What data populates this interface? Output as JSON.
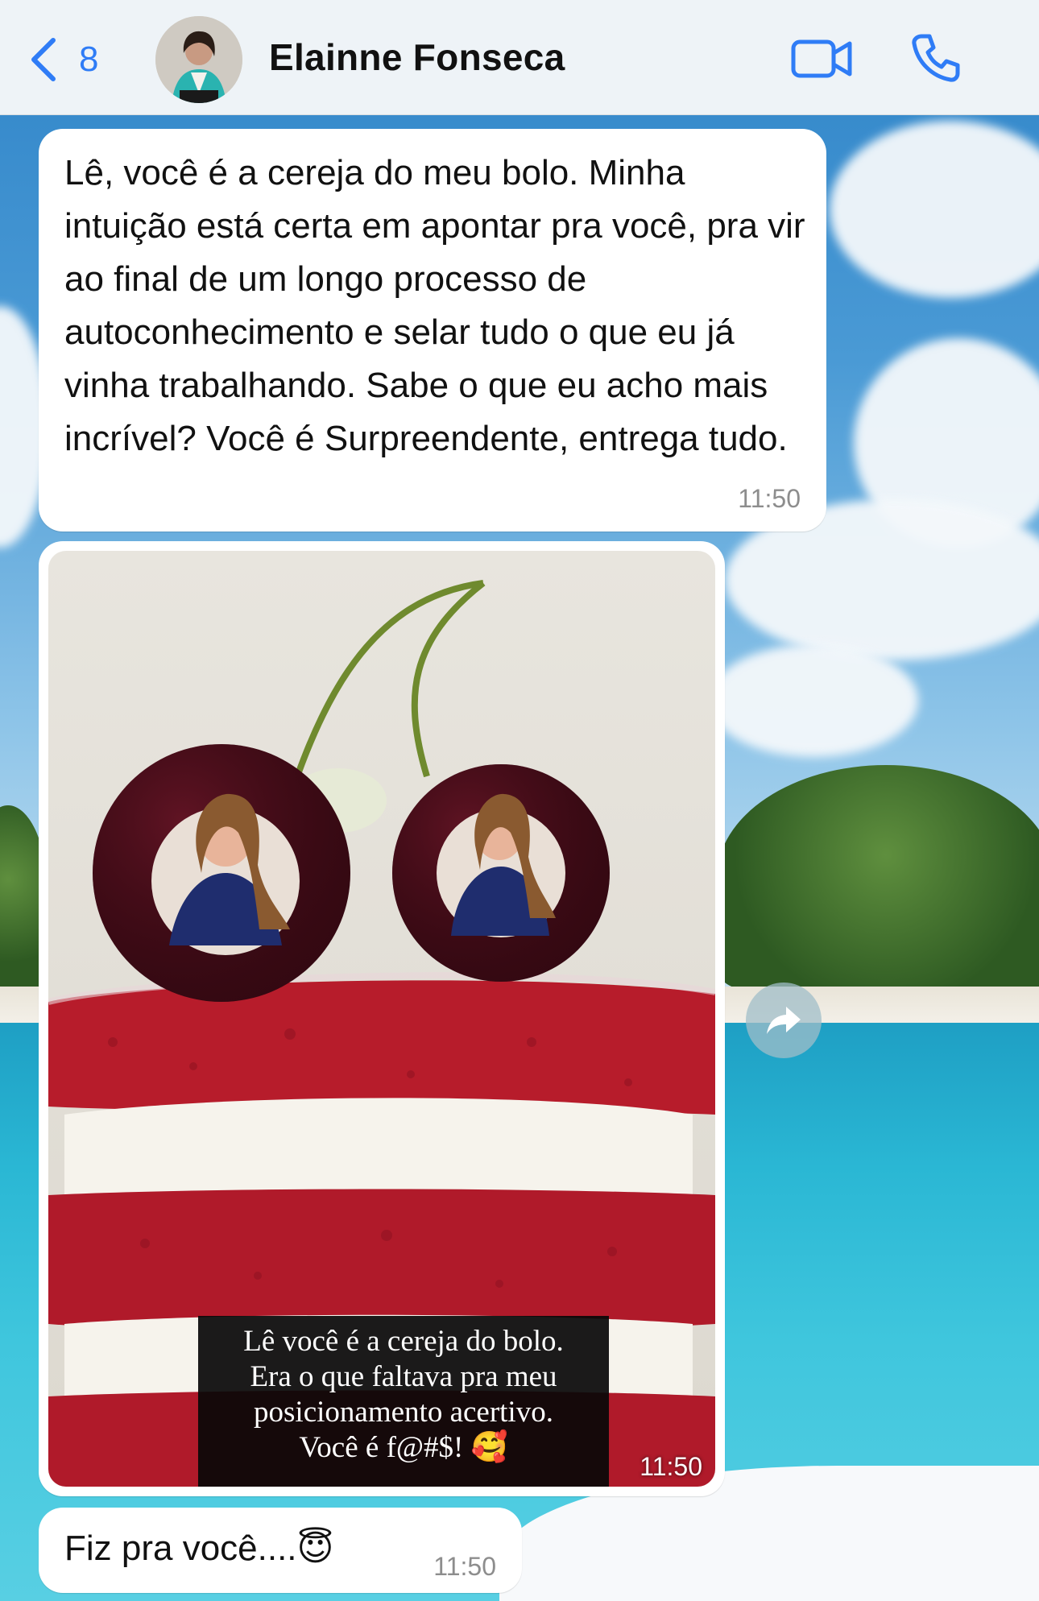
{
  "header": {
    "back_count": "8",
    "contact_name": "Elainne Fonseca",
    "icons": [
      "chevron-left-icon",
      "video-camera-icon",
      "phone-icon"
    ]
  },
  "messages": [
    {
      "text": "Lê, você é a cereja do meu bolo. Minha intuição está certa em apontar pra você, pra vir ao final de um longo processo de autoconhecimento e selar tudo o que eu já vinha trabalhando. Sabe o que eu acho mais incrível? Você é Surpreendente, entrega tudo.",
      "time": "11:50"
    },
    {
      "caption_lines": [
        "Lê você é a cereja do bolo.",
        "Era o que faltava pra meu",
        "posicionamento acertivo.",
        "Você é f@#$! 🥰"
      ],
      "time": "11:50"
    },
    {
      "text": "Fiz pra você....😇",
      "time": "11:50"
    }
  ],
  "colors": {
    "accent": "#2f7cf6",
    "bubble": "#ffffff",
    "timestamp": "#8d8d8d"
  }
}
